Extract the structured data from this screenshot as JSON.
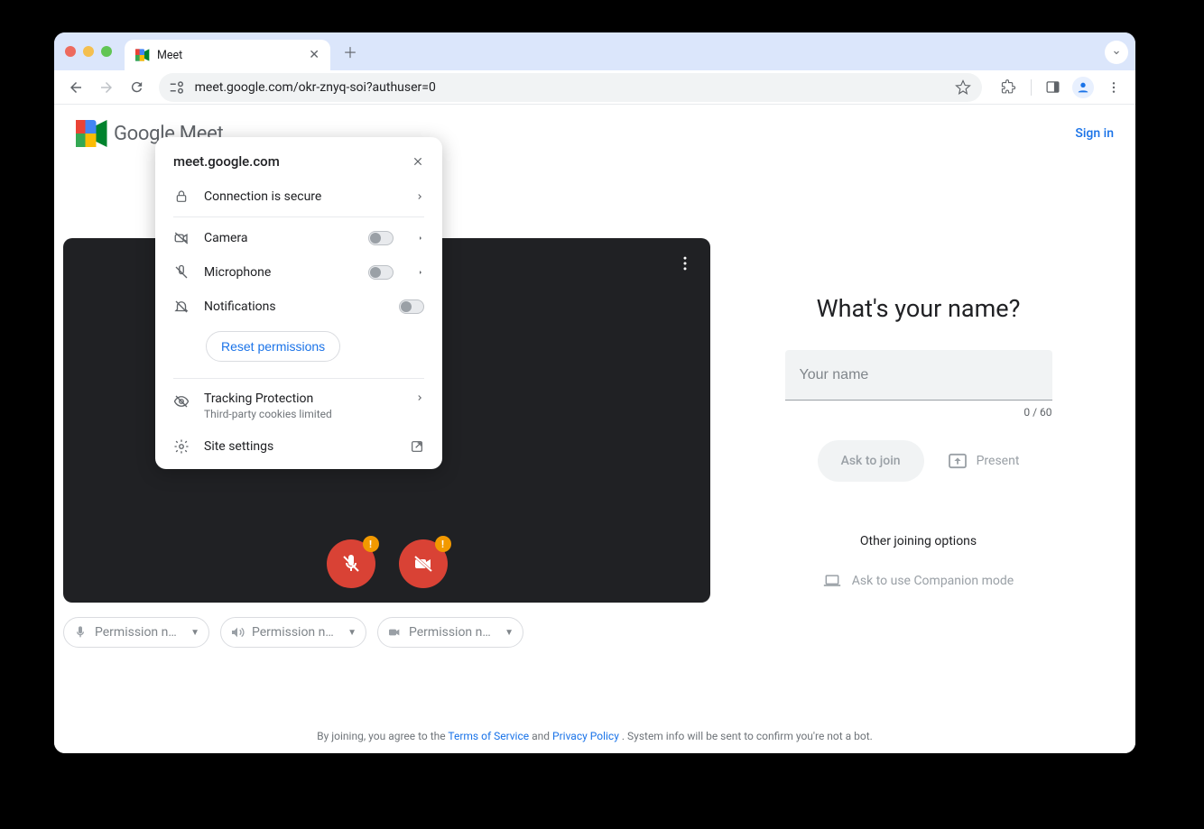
{
  "browser": {
    "tab_title": "Meet",
    "url": "meet.google.com/okr-znyq-soi?authuser=0"
  },
  "site_popover": {
    "domain": "meet.google.com",
    "secure": "Connection is secure",
    "camera": "Camera",
    "microphone": "Microphone",
    "notifications": "Notifications",
    "reset": "Reset permissions",
    "tracking": "Tracking Protection",
    "tracking_sub": "Third-party cookies limited",
    "site_settings": "Site settings"
  },
  "page": {
    "brand": "Google Meet",
    "sign_in": "Sign in",
    "heading": "What's your name?",
    "name_placeholder": "Your name",
    "name_value": "",
    "char_count": "0 / 60",
    "ask_to_join": "Ask to join",
    "present": "Present",
    "other_options": "Other joining options",
    "companion": "Ask to use Companion mode"
  },
  "chips": {
    "mic": "Permission ne…",
    "speaker": "Permission ne…",
    "camera": "Permission ne…"
  },
  "footer": {
    "prefix": "By joining, you agree to the ",
    "tos": "Terms of Service",
    "and": " and ",
    "privacy": "Privacy Policy",
    "suffix": ". System info will be sent to confirm you're not a bot."
  }
}
